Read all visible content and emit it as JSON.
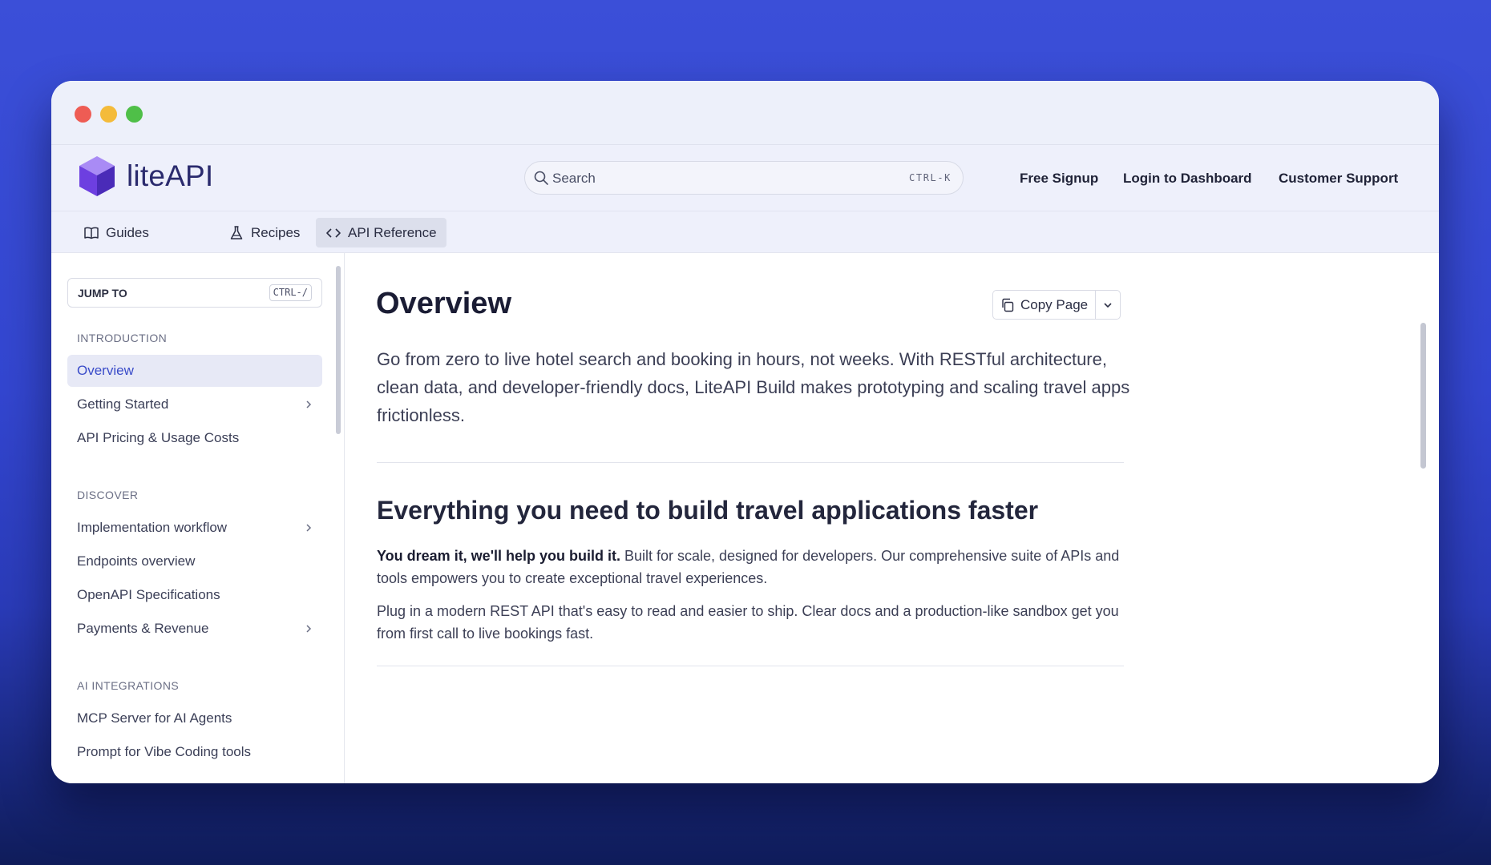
{
  "brand": {
    "name": "liteAPI"
  },
  "search": {
    "placeholder": "Search",
    "shortcut": "CTRL-K"
  },
  "header_nav": [
    {
      "label": "Free Signup"
    },
    {
      "label": "Login to Dashboard"
    },
    {
      "label": "Customer Support"
    }
  ],
  "tabs": [
    {
      "label": "Guides"
    },
    {
      "label": "Recipes"
    },
    {
      "label": "API Reference",
      "active": true
    }
  ],
  "sidebar": {
    "jump_to": {
      "label": "JUMP TO",
      "shortcut": "CTRL-/"
    },
    "sections": [
      {
        "title": "INTRODUCTION",
        "items": [
          {
            "label": "Overview",
            "active": true
          },
          {
            "label": "Getting Started",
            "expandable": true
          },
          {
            "label": "API Pricing & Usage Costs"
          }
        ]
      },
      {
        "title": "DISCOVER",
        "items": [
          {
            "label": "Implementation workflow",
            "expandable": true
          },
          {
            "label": "Endpoints overview"
          },
          {
            "label": "OpenAPI Specifications"
          },
          {
            "label": "Payments & Revenue",
            "expandable": true
          }
        ]
      },
      {
        "title": "AI INTEGRATIONS",
        "items": [
          {
            "label": "MCP Server for AI Agents"
          },
          {
            "label": "Prompt for Vibe Coding tools"
          }
        ]
      }
    ]
  },
  "main": {
    "title": "Overview",
    "copy_page_label": "Copy Page",
    "lead": "Go from zero to live hotel search and booking in hours, not weeks. With RESTful architecture, clean data, and developer-friendly docs, LiteAPI Build makes prototyping and scaling travel apps frictionless.",
    "section_title": "Everything you need to build travel applications faster",
    "para1_bold": "You dream it, we'll help you build it.",
    "para1_rest": " Built for scale, designed for developers. Our comprehensive suite of APIs and tools empowers you to create exceptional travel experiences.",
    "para2": "Plug in a modern REST API that's easy to read and easier to ship. Clear docs and a production-like sandbox get you from first call to live bookings fast."
  },
  "colors": {
    "accent": "#3a4cc9",
    "background": "#3346d0"
  }
}
